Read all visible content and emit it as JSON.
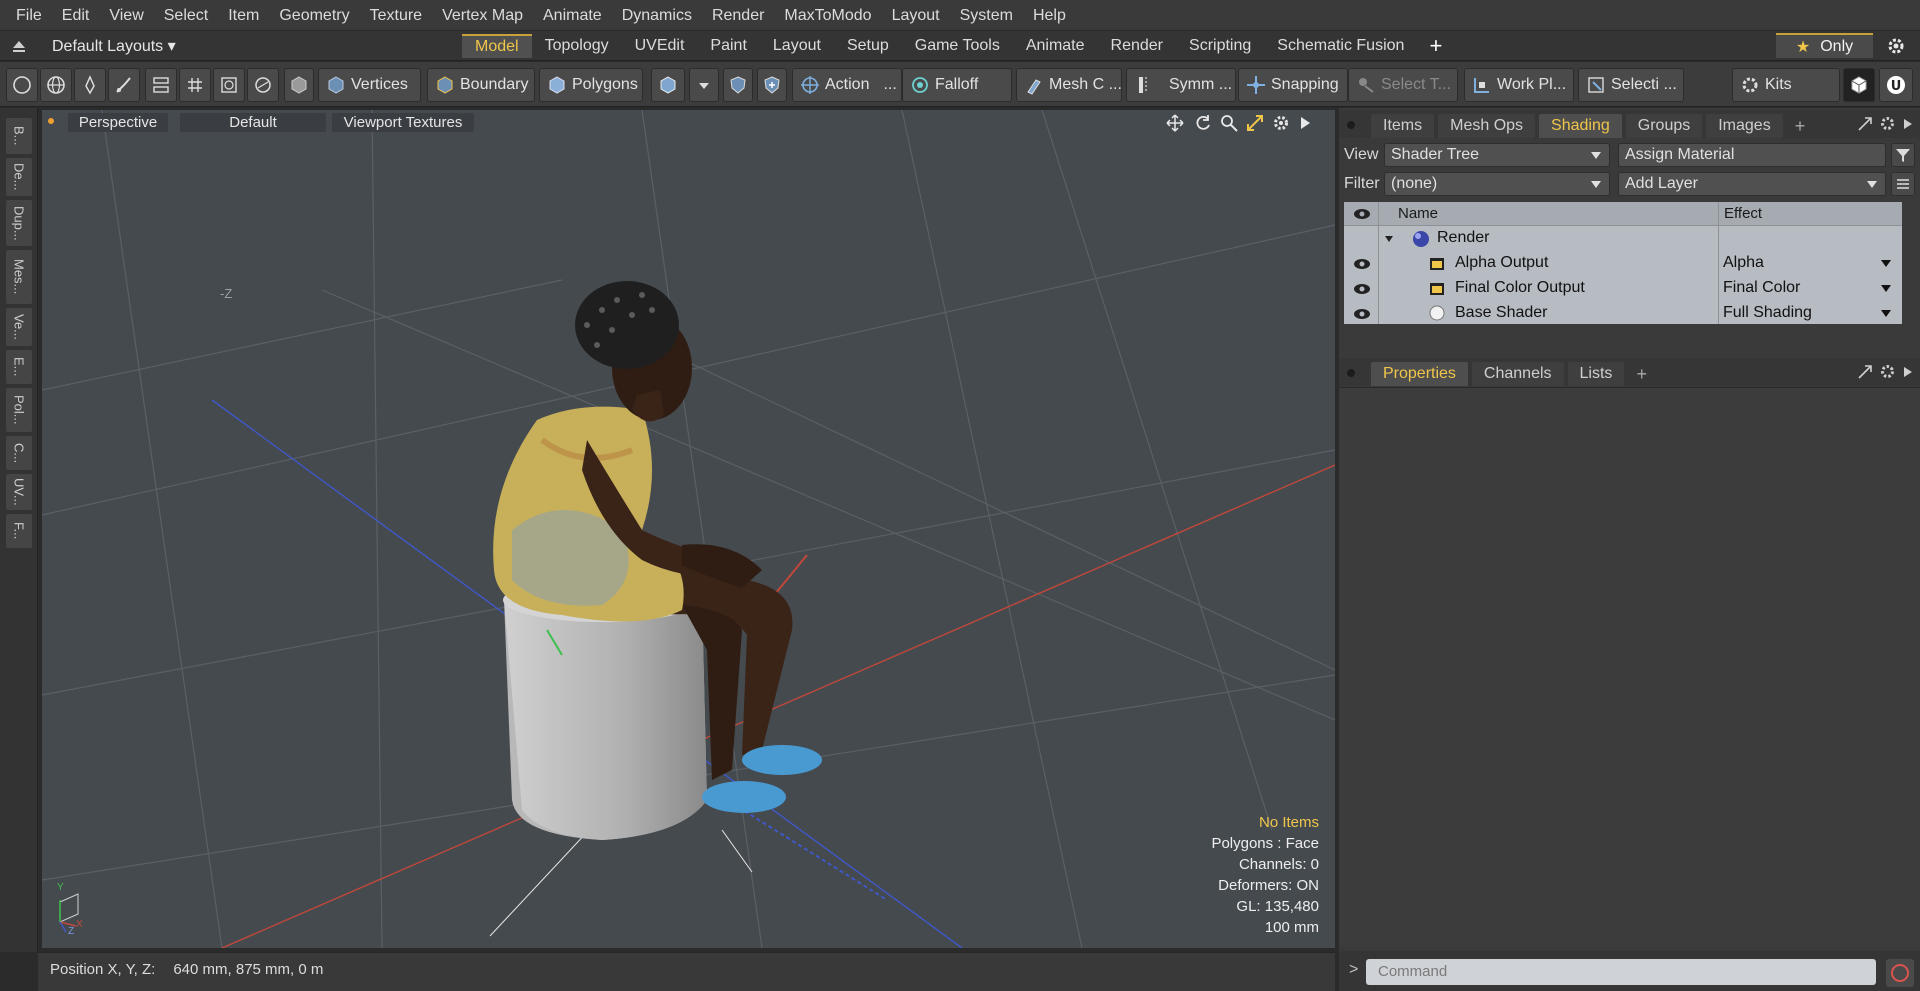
{
  "menu": [
    "File",
    "Edit",
    "View",
    "Select",
    "Item",
    "Geometry",
    "Texture",
    "Vertex Map",
    "Animate",
    "Dynamics",
    "Render",
    "MaxToModo",
    "Layout",
    "System",
    "Help"
  ],
  "layouts_label": "Default Layouts ▾",
  "tabs": [
    "Model",
    "Topology",
    "UVEdit",
    "Paint",
    "Layout",
    "Setup",
    "Game Tools",
    "Animate",
    "Render",
    "Scripting",
    "Schematic Fusion"
  ],
  "active_tab": "Model",
  "only_label": "Only",
  "toolbar": {
    "vertices": "Vertices",
    "boundary": "Boundary",
    "polygons": "Polygons",
    "action": "Action",
    "action_more": "...",
    "falloff": "Falloff",
    "mesh": "Mesh C ...",
    "symm": "Symm ...",
    "snapping": "Snapping",
    "select_t": "Select T...",
    "workpl": "Work Pl...",
    "selecti": "Selecti ...",
    "kits": "Kits"
  },
  "left_strip": [
    "B...",
    "De...",
    "Dup...",
    "Mes...",
    "Ve...",
    "E...",
    "Pol...",
    "C...",
    "UV...",
    "F..."
  ],
  "viewport": {
    "view_mode": "Perspective",
    "style": "Default",
    "textures": "Viewport Textures",
    "axis_label": "-Z",
    "info": {
      "items": "No Items",
      "polygons": "Polygons : Face",
      "channels": "Channels: 0",
      "deformers": "Deformers: ON",
      "gl": "GL: 135,480",
      "scale": "100 mm"
    },
    "gizmo": {
      "y": "Y",
      "x": "X",
      "z": "Z"
    }
  },
  "status": {
    "position_label": "Position X, Y, Z:",
    "position_value": "640 mm, 875 mm, 0 m"
  },
  "right_panel": {
    "top_tabs": [
      "Items",
      "Mesh Ops",
      "Shading",
      "Groups",
      "Images"
    ],
    "active_top_tab": "Shading",
    "view_label": "View",
    "view_value": "Shader Tree",
    "assign_material": "Assign Material",
    "filter_label": "Filter",
    "filter_value": "(none)",
    "add_layer": "Add Layer",
    "columns": {
      "name": "Name",
      "effect": "Effect"
    },
    "tree": [
      {
        "name": "Render",
        "effect": ""
      },
      {
        "name": "Alpha Output",
        "effect": "Alpha"
      },
      {
        "name": "Final Color Output",
        "effect": "Final Color"
      },
      {
        "name": "Base Shader",
        "effect": "Full Shading"
      }
    ],
    "bottom_tabs": [
      "Properties",
      "Channels",
      "Lists"
    ],
    "active_bottom_tab": "Properties",
    "command_placeholder": "Command",
    "command_prompt": ">"
  },
  "colors": {
    "accent": "#f0c64a",
    "viewport_bg": "#454a4f",
    "panel_bg": "#3a3a3a",
    "tree_bg": "#b7bcc2"
  }
}
